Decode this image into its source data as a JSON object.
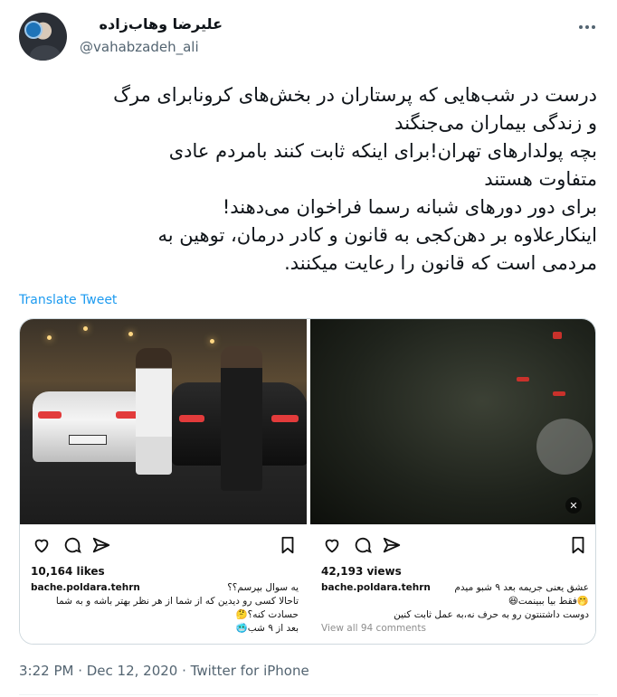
{
  "user": {
    "name": "علیرضا وهاب‌زاده",
    "handle": "@vahabzadeh_ali"
  },
  "tweet": {
    "lines": [
      "درست در شب‌هایی که پرستاران در بخش‌های کرونابرای مرگ",
      "و زندگی بیماران می‌جنگند",
      "بچه پولدارهای تهران!برای اینکه ثابت کنند بامردم عادی",
      "متفاوت هستند",
      "برای دور دورهای شبانه رسما فراخوان می‌دهند!",
      "اینکارعلاوه بر دهن‌کجی به قانون و کادر درمان، توهین به",
      "مردمی است که قانون را رعایت میکنند."
    ],
    "translate_label": "Translate Tweet",
    "meta": "3:22 PM · Dec 12, 2020 · Twitter for iPhone"
  },
  "posts": [
    {
      "stat": "10,164 likes",
      "username": "bache.poldara.tehrn",
      "caption_inline": "یه سوال بپرسم؟؟",
      "caption_lines": [
        "تاحالا کسی رو دیدین که از شما از هر نظر بهتر باشه و به شما",
        "حسادت کنه؟🤔",
        "بعد از ۹ شب🥶"
      ]
    },
    {
      "stat": "42,193 views",
      "username": "bache.poldara.tehrn",
      "caption_inline": "عشق یعنی جریمه بعد ۹ شبو میدم",
      "caption_lines": [
        "🤭فقط بیا ببینمت😆",
        "دوست داشتنتون رو به حرف نه،به عمل ثابت کنین"
      ],
      "view_comments": "View all 94 comments"
    }
  ],
  "icons": {
    "like": "heart-icon",
    "comment": "comment-icon",
    "share": "send-icon",
    "save": "bookmark-icon",
    "more": "more-dots-icon",
    "mute": "mute-icon"
  },
  "colors": {
    "link": "#1d9bf0",
    "secondary_text": "#536471",
    "border": "#cfd9de"
  }
}
